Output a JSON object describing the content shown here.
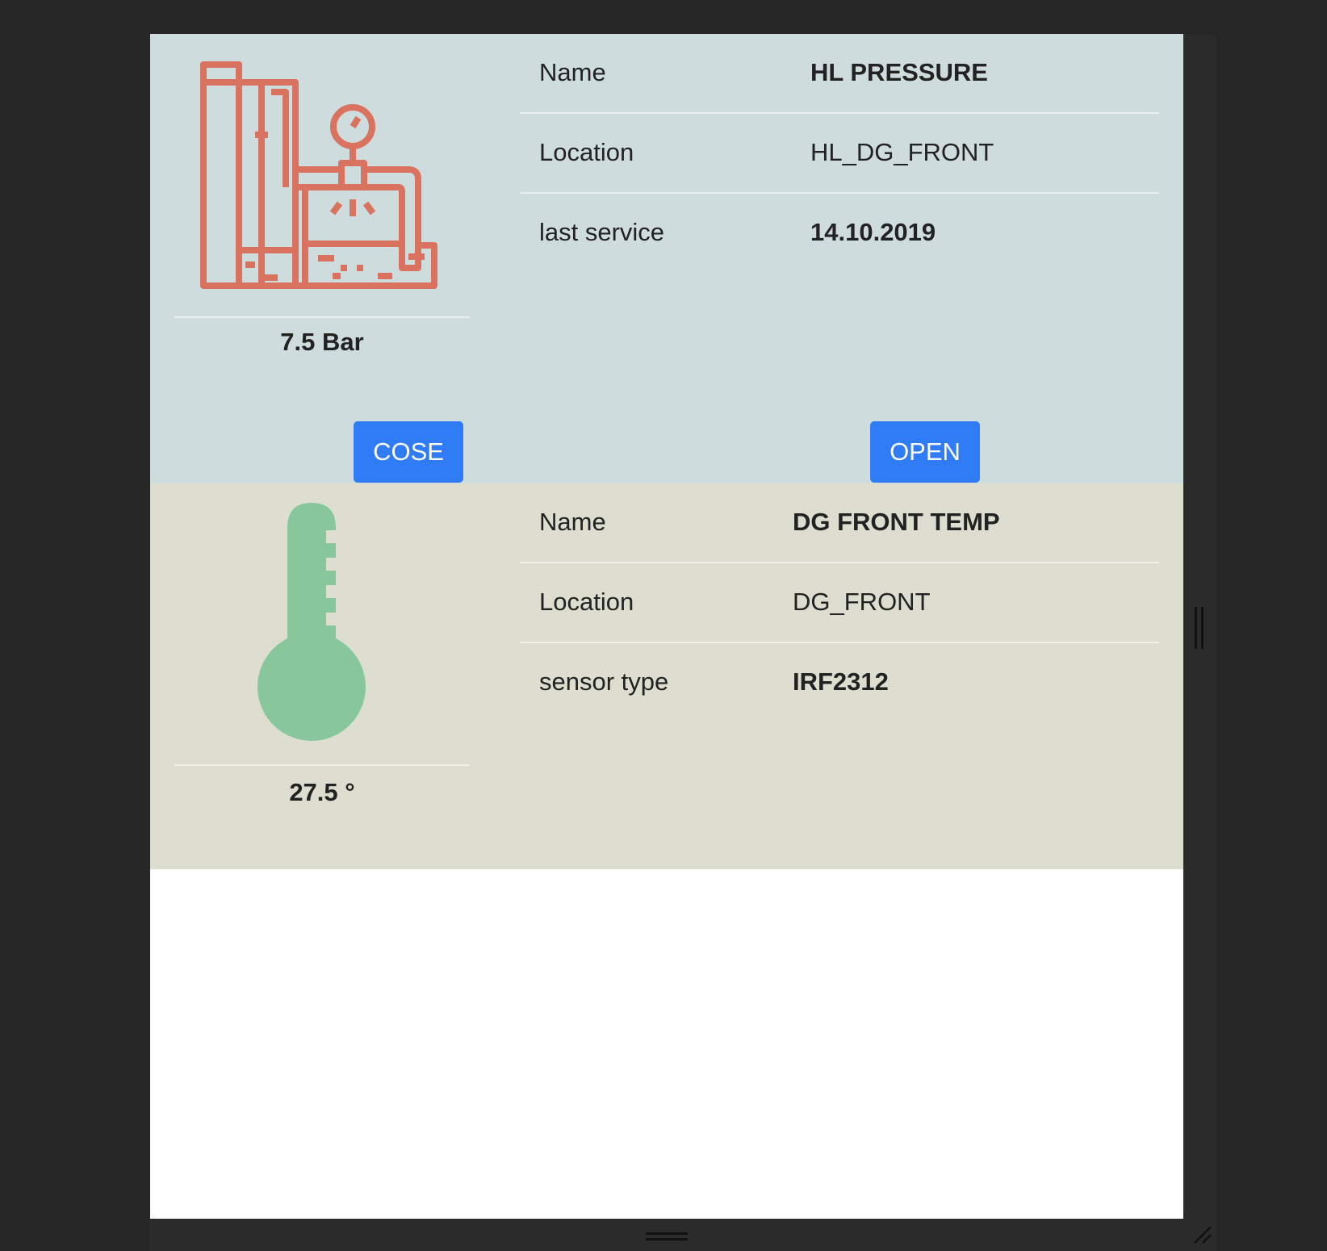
{
  "pressure_card": {
    "icon": "pressure-machine-icon",
    "reading": "7.5 Bar",
    "rows": [
      {
        "label": "Name",
        "value": "HL PRESSURE"
      },
      {
        "label": "Location",
        "value": "HL_DG_FRONT"
      },
      {
        "label": "last service",
        "value": "14.10.2019"
      }
    ],
    "close_label": "COSE",
    "open_label": "OPEN",
    "icon_color": "#d9735f",
    "background": "#cfdcdd"
  },
  "temp_card": {
    "icon": "thermometer-icon",
    "reading": "27.5 °",
    "rows": [
      {
        "label": "Name",
        "value": "DG FRONT TEMP"
      },
      {
        "label": "Location",
        "value": "DG_FRONT"
      },
      {
        "label": "sensor type",
        "value": "IRF2312"
      }
    ],
    "icon_color": "#88c69c",
    "background": "#dddecf"
  },
  "button_color": "#2f7cf6"
}
